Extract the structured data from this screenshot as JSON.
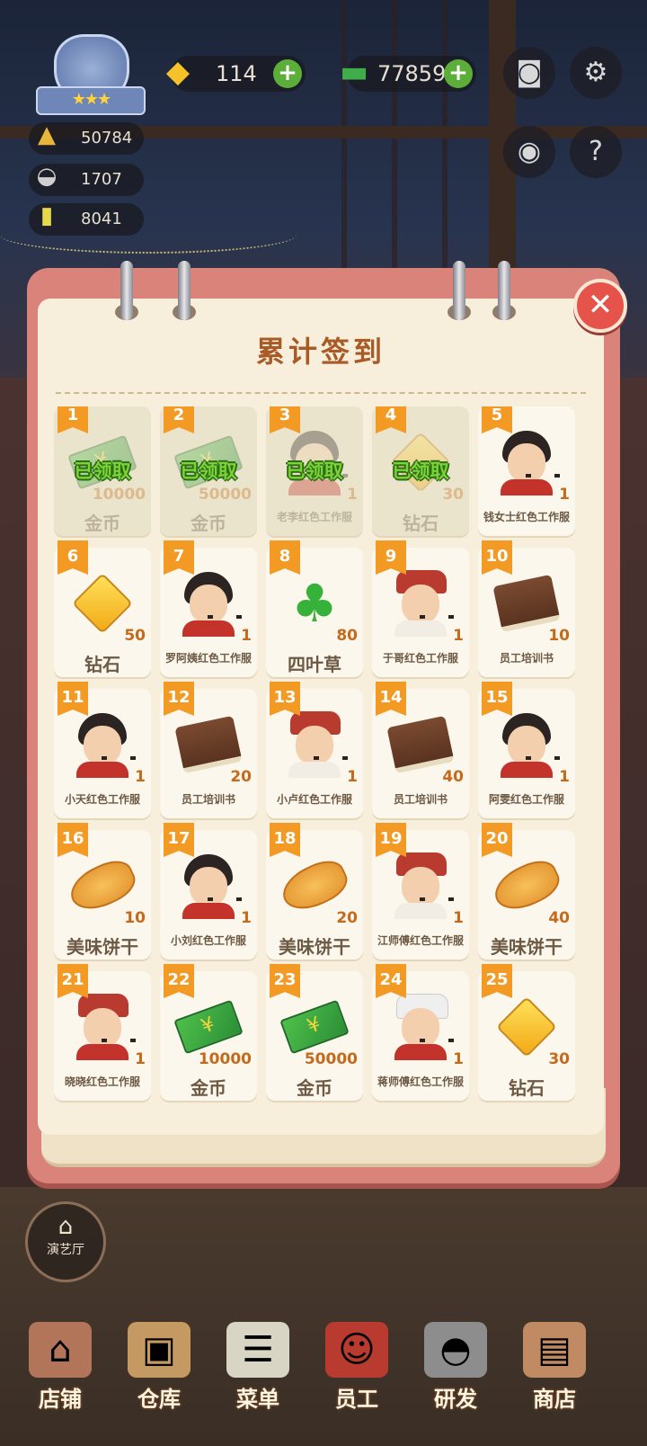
{
  "hud": {
    "rank_stars": "★★★",
    "gems": "114",
    "cash": "77859",
    "plus": "+",
    "stats": [
      "50784",
      "1707",
      "8041"
    ]
  },
  "dialog": {
    "title": "累计签到",
    "close": "✕",
    "claimed_label": "已领取",
    "rewards": [
      {
        "day": "1",
        "icon": "cash-icon",
        "qty": "10000",
        "name": "金币",
        "claimed": true
      },
      {
        "day": "2",
        "icon": "cash-icon",
        "qty": "50000",
        "name": "金币",
        "claimed": true
      },
      {
        "day": "3",
        "icon": "staff-icon",
        "qty": "1",
        "name": "老李红色工作服",
        "claimed": true
      },
      {
        "day": "4",
        "icon": "gem-icon",
        "qty": "30",
        "name": "钻石",
        "claimed": true
      },
      {
        "day": "5",
        "icon": "staff-icon",
        "qty": "1",
        "name": "钱女士红色工作服",
        "claimed": false
      },
      {
        "day": "6",
        "icon": "gem-icon",
        "qty": "50",
        "name": "钻石",
        "claimed": false
      },
      {
        "day": "7",
        "icon": "staff-icon",
        "qty": "1",
        "name": "罗阿姨红色工作服",
        "claimed": false
      },
      {
        "day": "8",
        "icon": "clover-icon",
        "qty": "80",
        "name": "四叶草",
        "claimed": false
      },
      {
        "day": "9",
        "icon": "staff-icon",
        "qty": "1",
        "name": "于哥红色工作服",
        "claimed": false
      },
      {
        "day": "10",
        "icon": "book-icon",
        "qty": "10",
        "name": "员工培训书",
        "claimed": false
      },
      {
        "day": "11",
        "icon": "staff-icon",
        "qty": "1",
        "name": "小天红色工作服",
        "claimed": false
      },
      {
        "day": "12",
        "icon": "book-icon",
        "qty": "20",
        "name": "员工培训书",
        "claimed": false
      },
      {
        "day": "13",
        "icon": "staff-icon",
        "qty": "1",
        "name": "小卢红色工作服",
        "claimed": false
      },
      {
        "day": "14",
        "icon": "book-icon",
        "qty": "40",
        "name": "员工培训书",
        "claimed": false
      },
      {
        "day": "15",
        "icon": "staff-icon",
        "qty": "1",
        "name": "阿雯红色工作服",
        "claimed": false
      },
      {
        "day": "16",
        "icon": "biscuit-icon",
        "qty": "10",
        "name": "美味饼干",
        "claimed": false
      },
      {
        "day": "17",
        "icon": "staff-icon",
        "qty": "1",
        "name": "小刘红色工作服",
        "claimed": false
      },
      {
        "day": "18",
        "icon": "biscuit-icon",
        "qty": "20",
        "name": "美味饼干",
        "claimed": false
      },
      {
        "day": "19",
        "icon": "staff-icon",
        "qty": "1",
        "name": "江师傅红色工作服",
        "claimed": false
      },
      {
        "day": "20",
        "icon": "biscuit-icon",
        "qty": "40",
        "name": "美味饼干",
        "claimed": false
      },
      {
        "day": "21",
        "icon": "staff-icon",
        "qty": "1",
        "name": "晓晓红色工作服",
        "claimed": false
      },
      {
        "day": "22",
        "icon": "cash-icon",
        "qty": "10000",
        "name": "金币",
        "claimed": false
      },
      {
        "day": "23",
        "icon": "cash-icon",
        "qty": "50000",
        "name": "金币",
        "claimed": false
      },
      {
        "day": "24",
        "icon": "staff-icon",
        "qty": "1",
        "name": "蒋师傅红色工作服",
        "claimed": false
      },
      {
        "day": "25",
        "icon": "gem-icon",
        "qty": "30",
        "name": "钻石",
        "claimed": false
      }
    ]
  },
  "side_button": "演艺厅",
  "nav": [
    "店铺",
    "仓库",
    "菜单",
    "员工",
    "研发",
    "商店"
  ],
  "colors": {
    "accent": "#f39a25",
    "title": "#a95b26",
    "claimed_stamp": "#7bd23a",
    "close": "#e5534b"
  }
}
